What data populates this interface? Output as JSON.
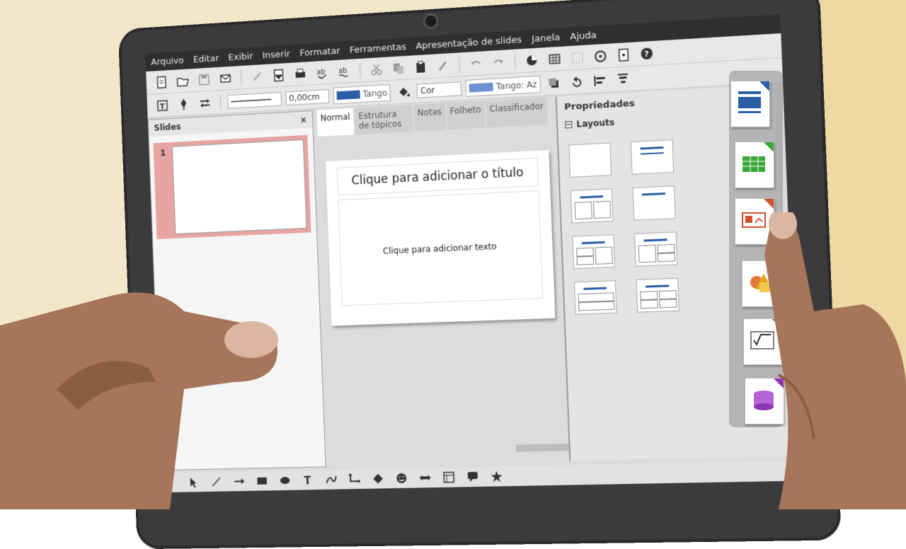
{
  "colors": {
    "background_cream": "#f2e8c9",
    "background_tan": "#efd9a3",
    "skin": "#a77559",
    "skin_dark": "#8a5e45",
    "nail": "#dbb6a0",
    "slide_highlight": "#e6a5a2",
    "accent_blue": "#2a5fa8",
    "fill_blue_light": "#6a92d0"
  },
  "menubar": {
    "items": [
      "Arquivo",
      "Editar",
      "Exibir",
      "Inserir",
      "Formatar",
      "Ferramentas",
      "Apresentação de slides",
      "Janela",
      "Ajuda"
    ]
  },
  "toolbar2": {
    "line_width": "0,00cm",
    "line_color_name": "Tango",
    "area_fill": "Cor",
    "area_color_name": "Tango: Az"
  },
  "slides_pane": {
    "title": "Slides",
    "close": "×",
    "thumb_number": "1"
  },
  "tabs": [
    "Normal",
    "Estrutura de tópicos",
    "Notas",
    "Folheto",
    "Classificador"
  ],
  "slide": {
    "title_placeholder": "Clique para adicionar o título",
    "text_placeholder": "Clique para adicionar texto"
  },
  "properties": {
    "title": "Propriedades",
    "section": "Layouts",
    "collapse_symbol": "−"
  },
  "dock_icons": [
    "writer-icon",
    "calc-icon",
    "impress-icon",
    "draw-icon",
    "math-icon",
    "base-icon"
  ]
}
